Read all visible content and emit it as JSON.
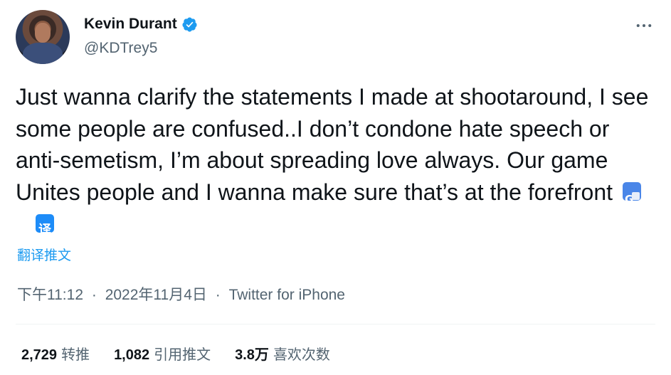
{
  "author": {
    "display_name": "Kevin Durant",
    "handle": "@KDTrey5",
    "verified_icon": "verified-badge-icon",
    "accent_color": "#1d9bf0"
  },
  "tweet": {
    "text": "Just wanna clarify the statements I made at shootaround, I see some people are confused..I don’t condone hate speech or anti-semetism, I’m about spreading love always. Our game Unites people and I wanna make sure that’s at the forefront",
    "translate_label": "翻译推文",
    "translate_icon_glyph": "译"
  },
  "meta": {
    "time": "下午11:12",
    "separator": "·",
    "date": "2022年11月4日",
    "source": "Twitter for iPhone"
  },
  "stats": {
    "retweets_count": "2,729",
    "retweets_label": "转推",
    "quotes_count": "1,082",
    "quotes_label": "引用推文",
    "likes_count": "3.8万",
    "likes_label": "喜欢次数"
  }
}
